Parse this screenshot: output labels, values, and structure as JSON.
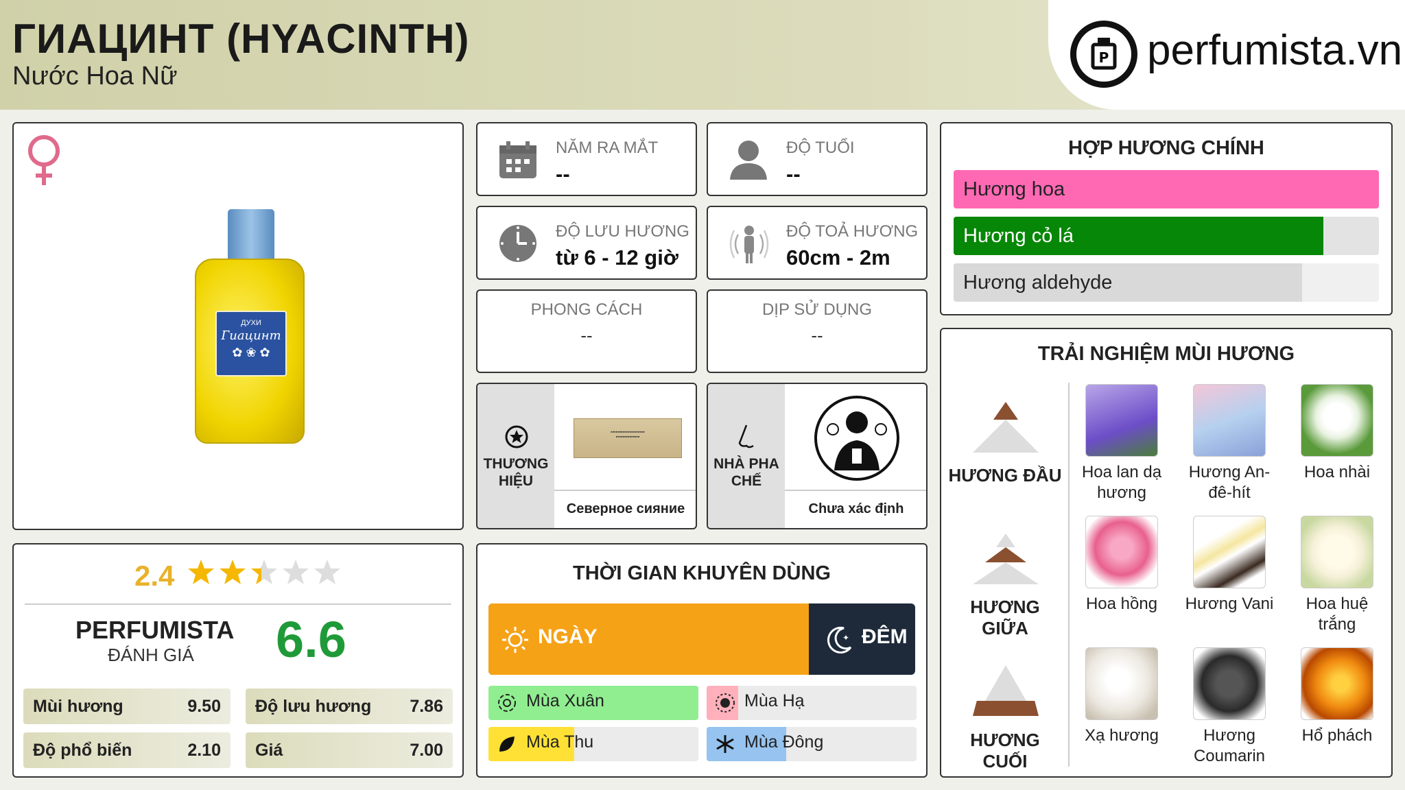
{
  "header": {
    "title": "ГИАЦИНТ (HYACINTH)",
    "subtitle": "Nước Hoa Nữ",
    "logo_text": "perfumista.vn"
  },
  "info": {
    "launch_year": {
      "label": "NĂM RA MẮT",
      "value": "--"
    },
    "age": {
      "label": "ĐỘ TUỔI",
      "value": "--"
    },
    "longevity": {
      "label": "ĐỘ LƯU HƯƠNG",
      "value": "từ 6 - 12 giờ"
    },
    "sillage": {
      "label": "ĐỘ TOẢ HƯƠNG",
      "value": "60cm - 2m"
    },
    "style": {
      "label": "PHONG CÁCH",
      "value": "--"
    },
    "occasion": {
      "label": "DỊP SỬ DỤNG",
      "value": "--"
    },
    "brand": {
      "label": "THƯƠNG HIỆU",
      "name": "Северное сияние"
    },
    "perfumer": {
      "label": "NHÀ PHA CHẾ",
      "name": "Chưa xác định"
    }
  },
  "product": {
    "label_line1": "ДУХИ",
    "label_line2": "Гиацинт"
  },
  "rating": {
    "stars_value": "2.4",
    "stars": 2.4,
    "brand_label": "PERFUMISTA",
    "eval_label": "ĐÁNH GIÁ",
    "score": "6.6",
    "items": [
      {
        "label": "Mùi hương",
        "value": "9.50"
      },
      {
        "label": "Độ lưu hương",
        "value": "7.86"
      },
      {
        "label": "Độ phổ biến",
        "value": "2.10"
      },
      {
        "label": "Giá",
        "value": "7.00"
      }
    ]
  },
  "accords": {
    "title": "HỢP HƯƠNG CHÍNH",
    "items": [
      {
        "label": "Hương hoa",
        "fill": 1.0,
        "color": "#ff69b4"
      },
      {
        "label": "Hương cỏ lá",
        "fill": 0.87,
        "color": "#078707"
      },
      {
        "label": "Hương aldehyde",
        "fill": 0.82,
        "color": "#d9d9d9"
      }
    ]
  },
  "time": {
    "title": "THỜI GIAN KHUYÊN DÙNG",
    "day": "NGÀY",
    "night": "ĐÊM",
    "day_fraction": 0.75,
    "seasons": [
      {
        "label": "Mùa Xuân",
        "fill": 1.0,
        "color": "#90ee90"
      },
      {
        "label": "Mùa Hạ",
        "fill": 0.15,
        "color": "#ffb0bb"
      },
      {
        "label": "Mùa Thu",
        "fill": 0.41,
        "color": "#ffe135"
      },
      {
        "label": "Mùa Đông",
        "fill": 0.38,
        "color": "#96c3ef"
      }
    ]
  },
  "notes": {
    "title": "TRẢI NGHIỆM MÙI HƯƠNG",
    "top": {
      "label": "HƯƠNG ĐẦU",
      "items": [
        "Hoa lan dạ hương",
        "Hương An-đê-hít",
        "Hoa nhài"
      ]
    },
    "middle": {
      "label": "HƯƠNG GIỮA",
      "items": [
        "Hoa hồng",
        "Hương Vani",
        "Hoa huệ trắng"
      ]
    },
    "base": {
      "label": "HƯƠNG CUỐI",
      "items": [
        "Xạ hương",
        "Hương Coumarin",
        "Hổ phách"
      ]
    }
  }
}
